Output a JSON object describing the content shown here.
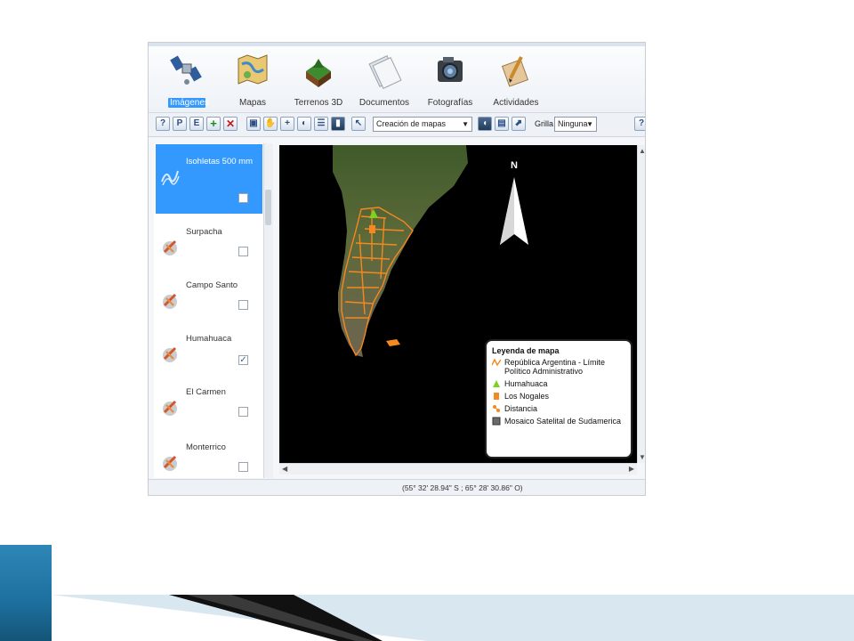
{
  "ribbon": {
    "items": [
      {
        "label": "Imágenes",
        "icon": "satellite-icon",
        "active": true
      },
      {
        "label": "Mapas",
        "icon": "map-icon",
        "active": false
      },
      {
        "label": "Terrenos 3D",
        "icon": "terrain-3d-icon",
        "active": false
      },
      {
        "label": "Documentos",
        "icon": "documents-icon",
        "active": false
      },
      {
        "label": "Fotografías",
        "icon": "camera-icon",
        "active": false
      },
      {
        "label": "Actividades",
        "icon": "activities-icon",
        "active": false
      }
    ]
  },
  "toolbar": {
    "mode_select": "Creación de mapas",
    "grid_label": "Grilla",
    "grid_select": "Ninguna"
  },
  "layers": [
    {
      "name": "Isohletas 500 mm",
      "checked": false,
      "selected": true
    },
    {
      "name": "Surpacha",
      "checked": false,
      "selected": false
    },
    {
      "name": "Campo Santo",
      "checked": false,
      "selected": false
    },
    {
      "name": "Humahuaca",
      "checked": true,
      "selected": false
    },
    {
      "name": "El Carmen",
      "checked": false,
      "selected": false
    },
    {
      "name": "Monterrico",
      "checked": false,
      "selected": false
    }
  ],
  "map": {
    "north_label": "N",
    "legend": {
      "title": "Leyenda de mapa",
      "items": [
        {
          "label": "República Argentina - Límite Político Administrativo",
          "symbol": "boundary-line-icon",
          "color": "#f5891f"
        },
        {
          "label": "Humahuaca",
          "symbol": "triangle-marker-icon",
          "color": "#7ed321"
        },
        {
          "label": "Los Nogales",
          "symbol": "square-marker-icon",
          "color": "#f5891f"
        },
        {
          "label": "Distancia",
          "symbol": "distance-icon",
          "color": "#f5891f"
        },
        {
          "label": "Mosaico Satelital de Sudamerica",
          "symbol": "raster-icon",
          "color": "#6b6b6b"
        }
      ]
    }
  },
  "status": {
    "coordinates": "(55° 32' 28.94\" S ; 65° 28' 30.86\" O)"
  },
  "colors": {
    "accent": "#3399ff",
    "boundary": "#f5891f",
    "deco_blue": "#1d6f9e"
  }
}
